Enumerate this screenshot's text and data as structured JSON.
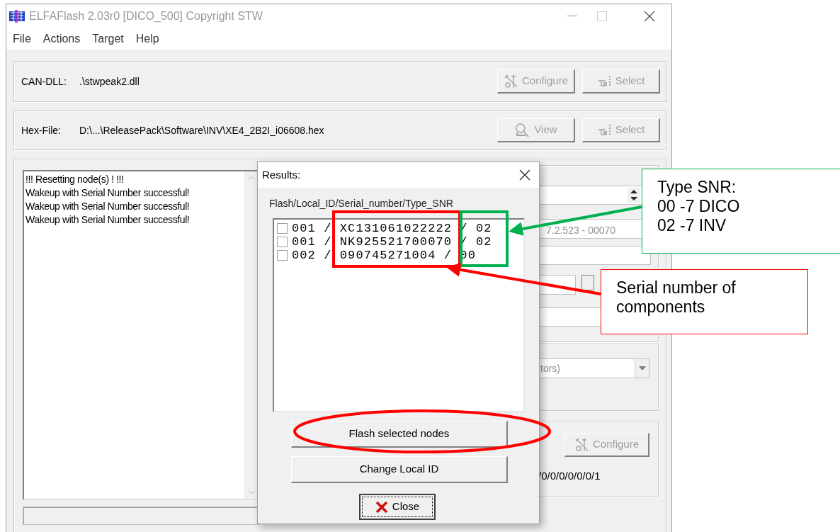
{
  "window": {
    "title": "ELFAFlash 2.03r0 [DICO_500]  Copyright STW"
  },
  "menu": [
    "File",
    "Actions",
    "Target",
    "Help"
  ],
  "can_dll": {
    "label": "CAN-DLL:",
    "value": ".\\stwpeak2.dll",
    "buttons": [
      {
        "kind": "configure",
        "label": "Configure",
        "disabled": true
      },
      {
        "kind": "select",
        "label": "Select",
        "disabled": true
      }
    ]
  },
  "hex_file": {
    "label": "Hex-File:",
    "value": "D:\\...\\ReleasePack\\Software\\INV\\XE4_2B2I_i06608.hex",
    "buttons": [
      {
        "kind": "view",
        "label": "View",
        "disabled": true
      },
      {
        "kind": "select",
        "label": "Select",
        "disabled": true
      }
    ]
  },
  "log": {
    "lines": [
      "!!! Resetting node(s) ! !!!",
      "Wakeup with Serial Number successful!",
      "Wakeup with Serial Number successful!",
      "Wakeup with Serial Number successful!"
    ]
  },
  "right_panel": {
    "version_text": "7.2.523 - 00070",
    "combo_text": "tors)",
    "configure_button": {
      "label": "Configure",
      "disabled": true
    },
    "address_text": "/0/0/0/0/0/0/1"
  },
  "results_dialog": {
    "title": "Results:",
    "list_header": "Flash/Local_ID/Serial_number/Type_SNR",
    "nodes": [
      {
        "checked": false,
        "text": "001 / XC131061022222 / 02"
      },
      {
        "checked": false,
        "text": "001 / NK925521700070 / 02"
      },
      {
        "checked": false,
        "text": "002 / 090745271004 / 00"
      }
    ],
    "buttons": [
      "Flash selected nodes",
      "Change Local ID"
    ],
    "close_button": "Close"
  },
  "highlights": [
    {
      "kind": "rectangle",
      "color": "#ff0000"
    },
    {
      "kind": "rectangle",
      "color": "#00b050"
    },
    {
      "kind": "ellipse",
      "color": "#ff0000"
    }
  ],
  "annotations": [
    {
      "lines": [
        "Type SNR:",
        "00 -7 DICO",
        "02 -7 INV"
      ],
      "color": "#00b050"
    },
    {
      "lines": [
        "Serial number of",
        "components"
      ],
      "color": "#ff0000"
    }
  ]
}
